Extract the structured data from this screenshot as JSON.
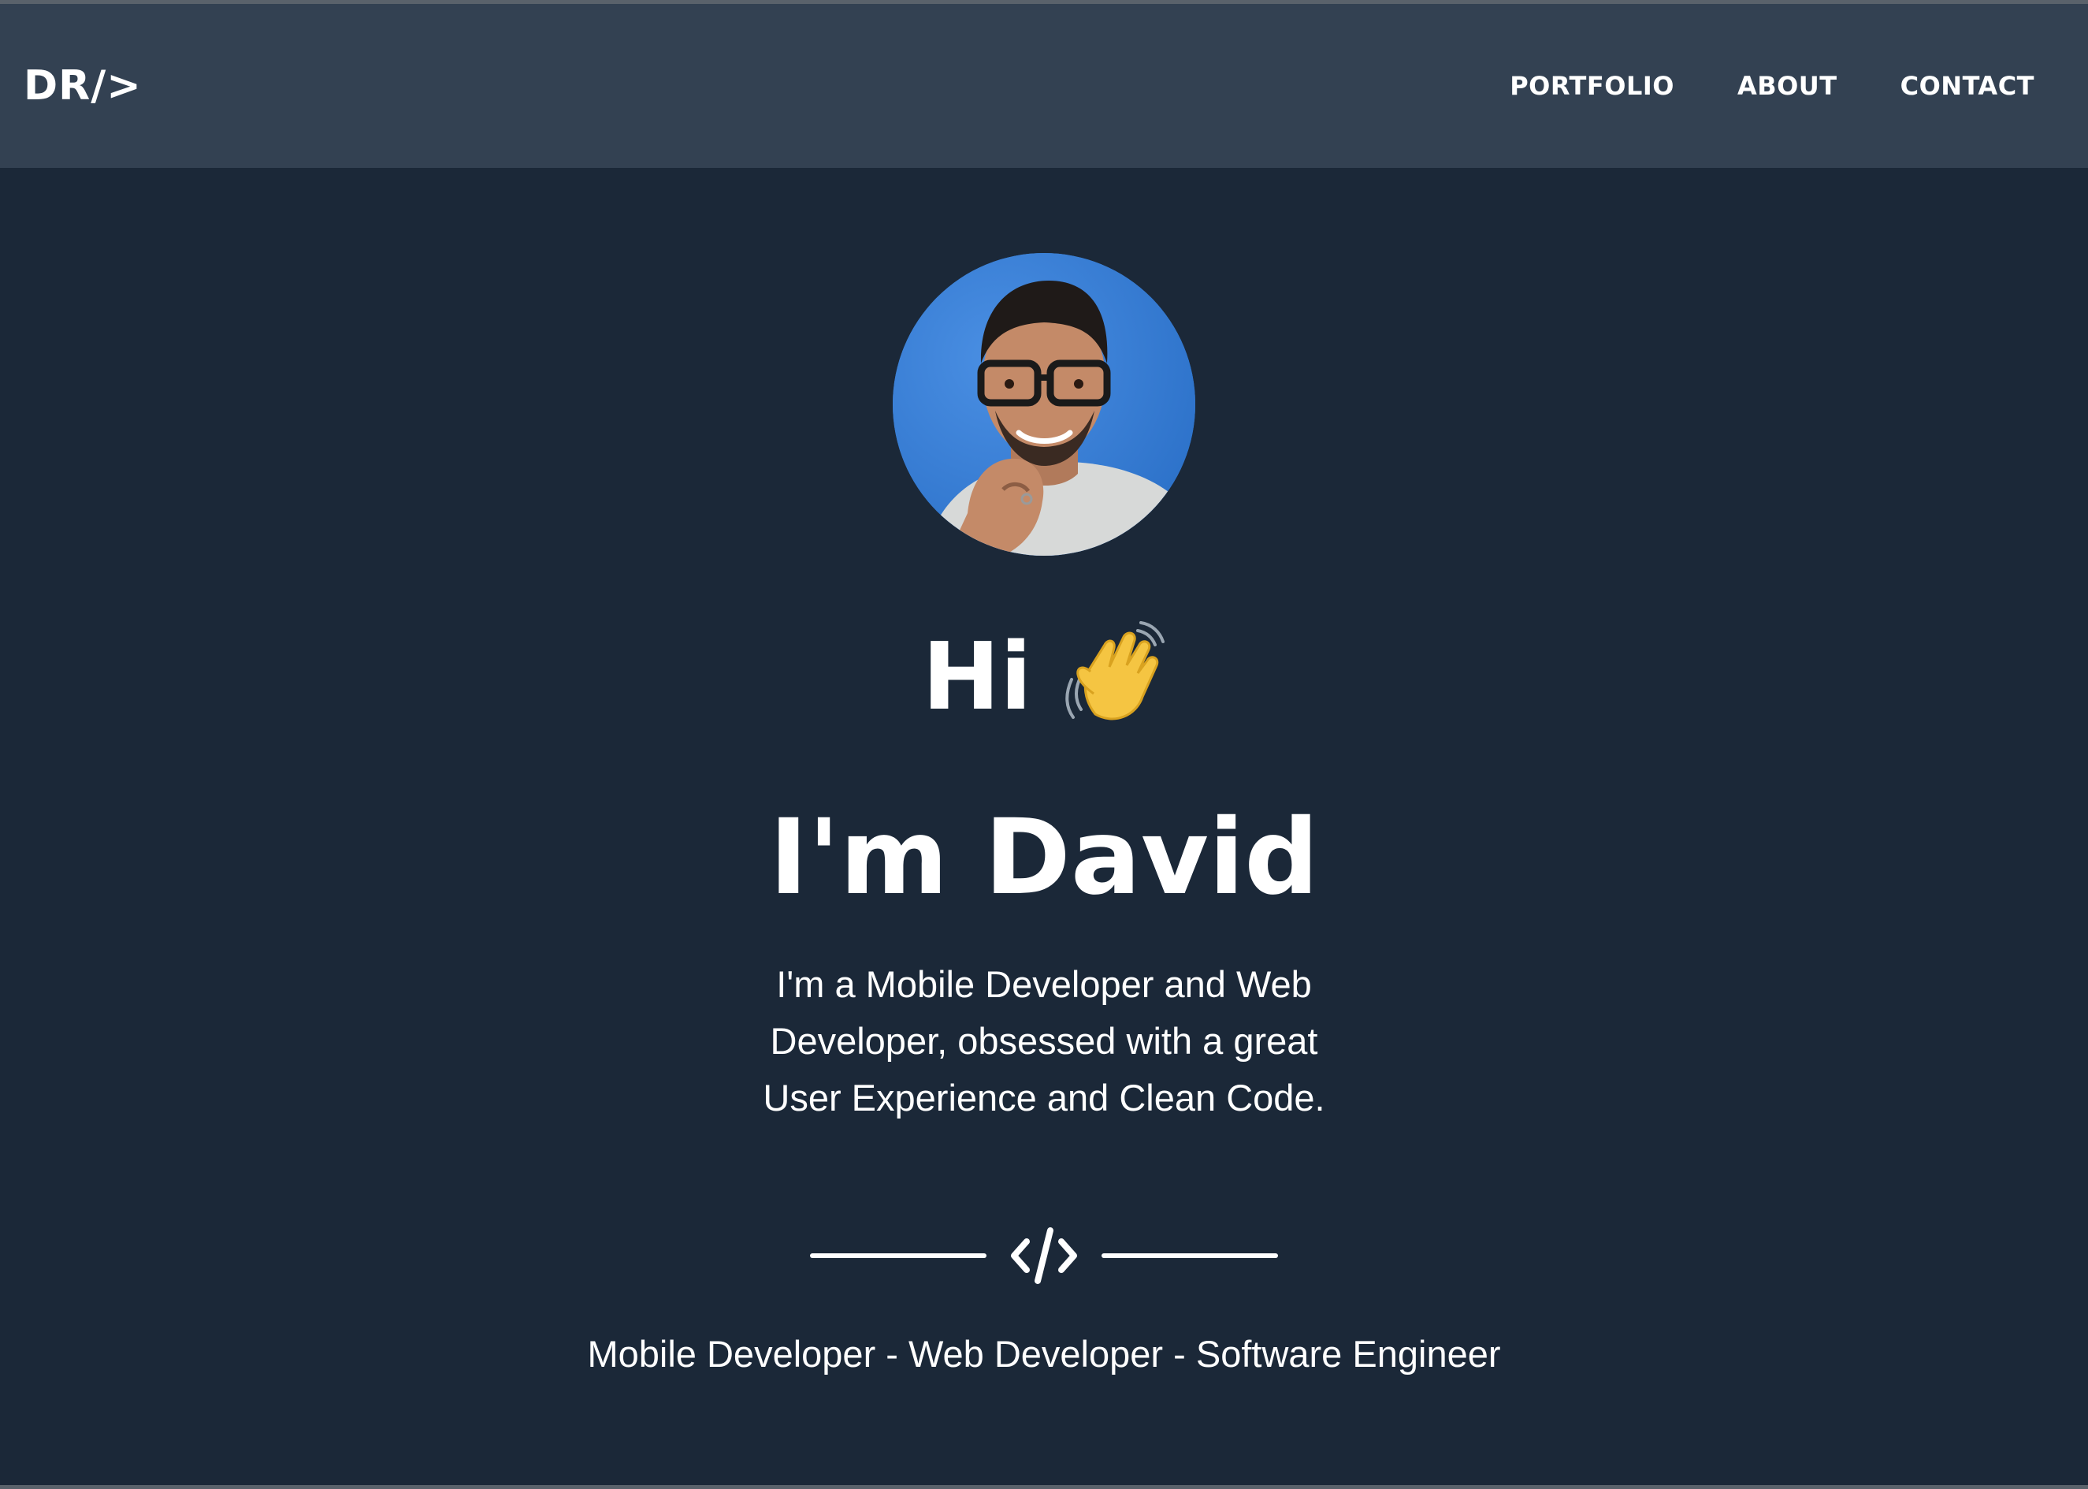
{
  "nav": {
    "logo": "DR/>",
    "links": [
      {
        "label": "PORTFOLIO"
      },
      {
        "label": "ABOUT"
      },
      {
        "label": "CONTACT"
      }
    ]
  },
  "hero": {
    "avatar_alt": "Profile photo of David",
    "greeting": "Hi",
    "greeting_icon": "waving-hand-icon",
    "name_title": "I'm David",
    "intro": "I'm a Mobile Developer and Web Developer, obsessed with a great User Experience and Clean Code.",
    "divider_icon": "code-icon",
    "roles": "Mobile Developer - Web Developer - Software Engineer"
  },
  "colors": {
    "background": "#1b2838",
    "navbar": "#334152",
    "text": "#ffffff",
    "avatar_bg": "#3c82d9"
  }
}
